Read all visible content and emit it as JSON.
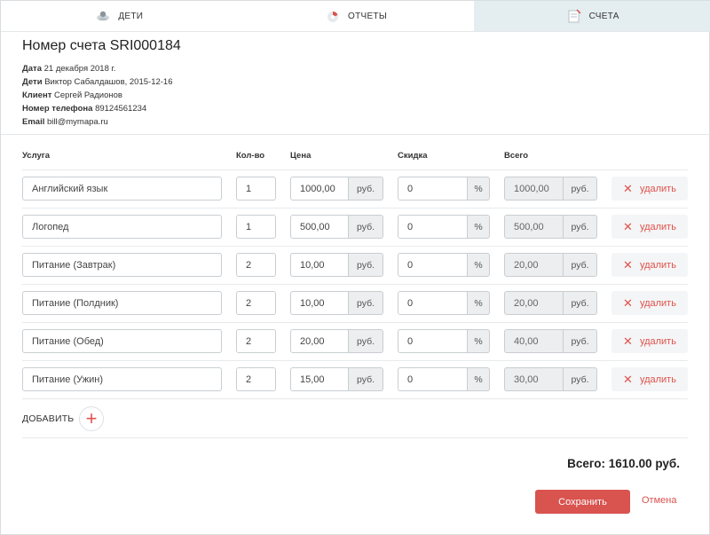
{
  "tabs": [
    {
      "label": "ДЕТИ",
      "icon": "children-icon",
      "active": false
    },
    {
      "label": "ОТЧЕТЫ",
      "icon": "reports-icon",
      "active": false
    },
    {
      "label": "СЧЕТА",
      "icon": "invoices-icon",
      "active": true
    }
  ],
  "invoice": {
    "title": "Номер счета SRI000184",
    "fields": [
      {
        "label": "Дата",
        "value": "21 декабря 2018 г."
      },
      {
        "label": "Дети",
        "value": "Виктор Сабалдашов, 2015-12-16"
      },
      {
        "label": "Клиент",
        "value": "Сергей Радионов"
      },
      {
        "label": "Номер телефона",
        "value": "89124561234"
      },
      {
        "label": "Email",
        "value": "bill@mymapa.ru"
      }
    ]
  },
  "table": {
    "headers": {
      "service": "Услуга",
      "qty": "Кол-во",
      "price": "Цена",
      "discount": "Скидка",
      "total": "Всего"
    },
    "currency_unit": "руб.",
    "percent_unit": "%",
    "delete_label": "удалить",
    "rows": [
      {
        "service": "Английский язык",
        "qty": "1",
        "price": "1000,00",
        "discount": "0",
        "total": "1000,00"
      },
      {
        "service": "Логопед",
        "qty": "1",
        "price": "500,00",
        "discount": "0",
        "total": "500,00"
      },
      {
        "service": "Питание (Завтрак)",
        "qty": "2",
        "price": "10,00",
        "discount": "0",
        "total": "20,00"
      },
      {
        "service": "Питание (Полдник)",
        "qty": "2",
        "price": "10,00",
        "discount": "0",
        "total": "20,00"
      },
      {
        "service": "Питание (Обед)",
        "qty": "2",
        "price": "20,00",
        "discount": "0",
        "total": "40,00"
      },
      {
        "service": "Питание (Ужин)",
        "qty": "2",
        "price": "15,00",
        "discount": "0",
        "total": "30,00"
      }
    ]
  },
  "add_label": "ДОБАВИТЬ",
  "grand_total": "Всего: 1610.00 руб.",
  "save_label": "Сохранить",
  "cancel_label": "Отмена",
  "colors": {
    "accent": "#d9534f",
    "active_tab": "#e4eef1"
  }
}
